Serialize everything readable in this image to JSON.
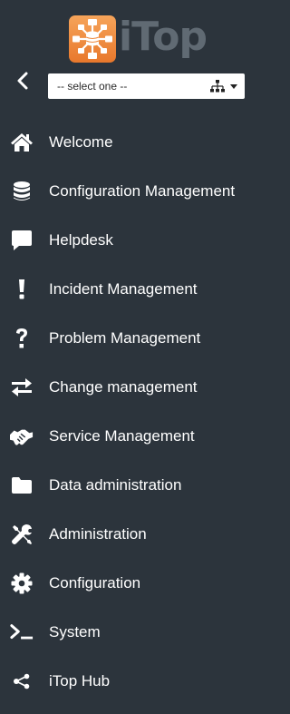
{
  "brand": {
    "name": "iTop"
  },
  "organization_select": {
    "value": "-- select one --"
  },
  "menu": {
    "items": [
      {
        "label": "Welcome",
        "icon": "home-icon"
      },
      {
        "label": "Configuration Management",
        "icon": "database-icon"
      },
      {
        "label": "Helpdesk",
        "icon": "speech-bubble-icon"
      },
      {
        "label": "Incident Management",
        "icon": "exclamation-icon"
      },
      {
        "label": "Problem Management",
        "icon": "question-icon"
      },
      {
        "label": "Change management",
        "icon": "exchange-arrows-icon"
      },
      {
        "label": "Service Management",
        "icon": "handshake-icon"
      },
      {
        "label": "Data administration",
        "icon": "folder-icon"
      },
      {
        "label": "Administration",
        "icon": "tools-icon"
      },
      {
        "label": "Configuration",
        "icon": "gear-icon"
      },
      {
        "label": "System",
        "icon": "terminal-icon"
      },
      {
        "label": "iTop Hub",
        "icon": "share-icon"
      }
    ]
  },
  "colors": {
    "sidebar_bg": "#2c343c",
    "logo_orange": "#ee8a3e",
    "logo_text": "#606a73",
    "text": "#ffffff"
  }
}
